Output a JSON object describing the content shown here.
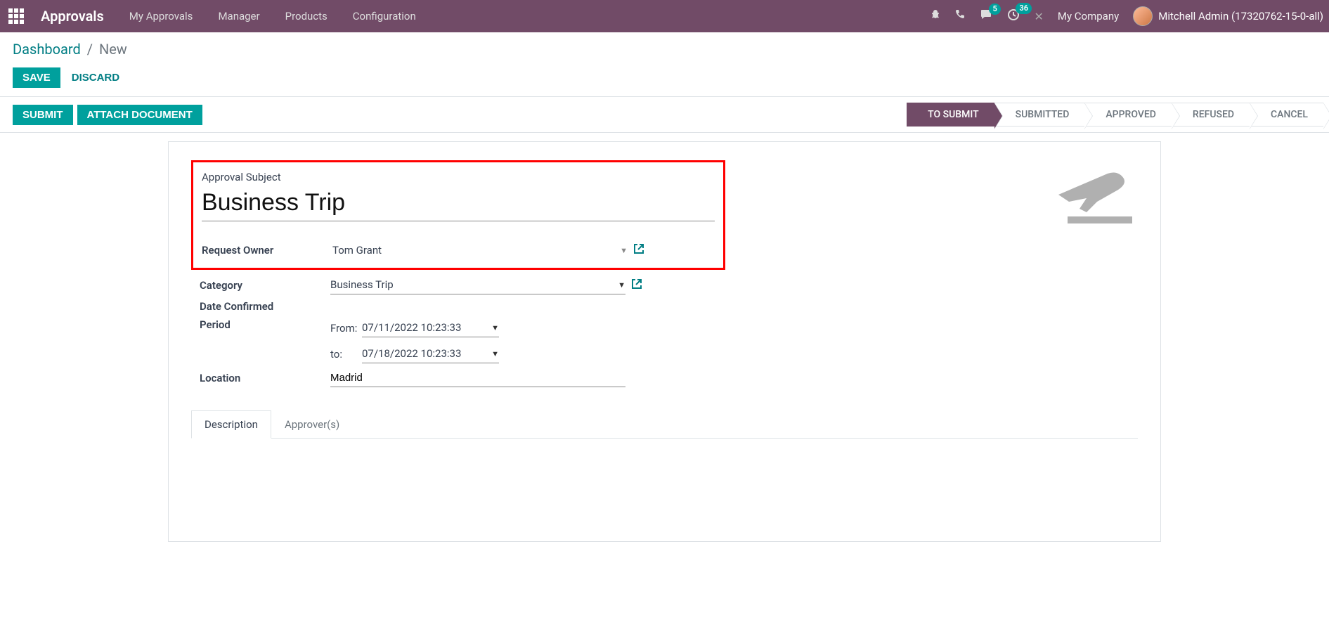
{
  "navbar": {
    "brand": "Approvals",
    "menu": [
      "My Approvals",
      "Manager",
      "Products",
      "Configuration"
    ],
    "badges": {
      "messages": "5",
      "activities": "36"
    },
    "company": "My Company",
    "username": "Mitchell Admin (17320762-15-0-all)"
  },
  "breadcrumb": {
    "parent": "Dashboard",
    "current": "New",
    "save": "SAVE",
    "discard": "DISCARD"
  },
  "statusbar": {
    "submit": "SUBMIT",
    "attach": "ATTACH DOCUMENT",
    "steps": [
      "TO SUBMIT",
      "SUBMITTED",
      "APPROVED",
      "REFUSED",
      "CANCEL"
    ]
  },
  "form": {
    "subject_label": "Approval Subject",
    "subject": "Business Trip",
    "labels": {
      "owner": "Request Owner",
      "category": "Category",
      "date_confirmed": "Date Confirmed",
      "period": "Period",
      "from": "From:",
      "to": "to:",
      "location": "Location"
    },
    "values": {
      "owner": "Tom Grant",
      "category": "Business Trip",
      "from": "07/11/2022 10:23:33",
      "to": "07/18/2022 10:23:33",
      "location": "Madrid"
    }
  },
  "tabs": {
    "description": "Description",
    "approvers": "Approver(s)"
  }
}
